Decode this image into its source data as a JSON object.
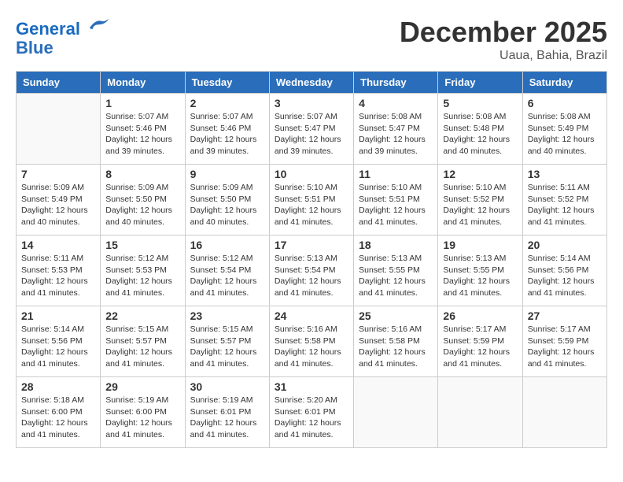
{
  "header": {
    "logo_line1": "General",
    "logo_line2": "Blue",
    "month": "December 2025",
    "location": "Uaua, Bahia, Brazil"
  },
  "weekdays": [
    "Sunday",
    "Monday",
    "Tuesday",
    "Wednesday",
    "Thursday",
    "Friday",
    "Saturday"
  ],
  "weeks": [
    [
      {
        "day": "",
        "empty": true
      },
      {
        "day": "1",
        "sunrise": "5:07 AM",
        "sunset": "5:46 PM",
        "daylight": "12 hours and 39 minutes."
      },
      {
        "day": "2",
        "sunrise": "5:07 AM",
        "sunset": "5:46 PM",
        "daylight": "12 hours and 39 minutes."
      },
      {
        "day": "3",
        "sunrise": "5:07 AM",
        "sunset": "5:47 PM",
        "daylight": "12 hours and 39 minutes."
      },
      {
        "day": "4",
        "sunrise": "5:08 AM",
        "sunset": "5:47 PM",
        "daylight": "12 hours and 39 minutes."
      },
      {
        "day": "5",
        "sunrise": "5:08 AM",
        "sunset": "5:48 PM",
        "daylight": "12 hours and 40 minutes."
      },
      {
        "day": "6",
        "sunrise": "5:08 AM",
        "sunset": "5:49 PM",
        "daylight": "12 hours and 40 minutes."
      }
    ],
    [
      {
        "day": "7",
        "sunrise": "5:09 AM",
        "sunset": "5:49 PM",
        "daylight": "12 hours and 40 minutes."
      },
      {
        "day": "8",
        "sunrise": "5:09 AM",
        "sunset": "5:50 PM",
        "daylight": "12 hours and 40 minutes."
      },
      {
        "day": "9",
        "sunrise": "5:09 AM",
        "sunset": "5:50 PM",
        "daylight": "12 hours and 40 minutes."
      },
      {
        "day": "10",
        "sunrise": "5:10 AM",
        "sunset": "5:51 PM",
        "daylight": "12 hours and 41 minutes."
      },
      {
        "day": "11",
        "sunrise": "5:10 AM",
        "sunset": "5:51 PM",
        "daylight": "12 hours and 41 minutes."
      },
      {
        "day": "12",
        "sunrise": "5:10 AM",
        "sunset": "5:52 PM",
        "daylight": "12 hours and 41 minutes."
      },
      {
        "day": "13",
        "sunrise": "5:11 AM",
        "sunset": "5:52 PM",
        "daylight": "12 hours and 41 minutes."
      }
    ],
    [
      {
        "day": "14",
        "sunrise": "5:11 AM",
        "sunset": "5:53 PM",
        "daylight": "12 hours and 41 minutes."
      },
      {
        "day": "15",
        "sunrise": "5:12 AM",
        "sunset": "5:53 PM",
        "daylight": "12 hours and 41 minutes."
      },
      {
        "day": "16",
        "sunrise": "5:12 AM",
        "sunset": "5:54 PM",
        "daylight": "12 hours and 41 minutes."
      },
      {
        "day": "17",
        "sunrise": "5:13 AM",
        "sunset": "5:54 PM",
        "daylight": "12 hours and 41 minutes."
      },
      {
        "day": "18",
        "sunrise": "5:13 AM",
        "sunset": "5:55 PM",
        "daylight": "12 hours and 41 minutes."
      },
      {
        "day": "19",
        "sunrise": "5:13 AM",
        "sunset": "5:55 PM",
        "daylight": "12 hours and 41 minutes."
      },
      {
        "day": "20",
        "sunrise": "5:14 AM",
        "sunset": "5:56 PM",
        "daylight": "12 hours and 41 minutes."
      }
    ],
    [
      {
        "day": "21",
        "sunrise": "5:14 AM",
        "sunset": "5:56 PM",
        "daylight": "12 hours and 41 minutes."
      },
      {
        "day": "22",
        "sunrise": "5:15 AM",
        "sunset": "5:57 PM",
        "daylight": "12 hours and 41 minutes."
      },
      {
        "day": "23",
        "sunrise": "5:15 AM",
        "sunset": "5:57 PM",
        "daylight": "12 hours and 41 minutes."
      },
      {
        "day": "24",
        "sunrise": "5:16 AM",
        "sunset": "5:58 PM",
        "daylight": "12 hours and 41 minutes."
      },
      {
        "day": "25",
        "sunrise": "5:16 AM",
        "sunset": "5:58 PM",
        "daylight": "12 hours and 41 minutes."
      },
      {
        "day": "26",
        "sunrise": "5:17 AM",
        "sunset": "5:59 PM",
        "daylight": "12 hours and 41 minutes."
      },
      {
        "day": "27",
        "sunrise": "5:17 AM",
        "sunset": "5:59 PM",
        "daylight": "12 hours and 41 minutes."
      }
    ],
    [
      {
        "day": "28",
        "sunrise": "5:18 AM",
        "sunset": "6:00 PM",
        "daylight": "12 hours and 41 minutes."
      },
      {
        "day": "29",
        "sunrise": "5:19 AM",
        "sunset": "6:00 PM",
        "daylight": "12 hours and 41 minutes."
      },
      {
        "day": "30",
        "sunrise": "5:19 AM",
        "sunset": "6:01 PM",
        "daylight": "12 hours and 41 minutes."
      },
      {
        "day": "31",
        "sunrise": "5:20 AM",
        "sunset": "6:01 PM",
        "daylight": "12 hours and 41 minutes."
      },
      {
        "day": "",
        "empty": true
      },
      {
        "day": "",
        "empty": true
      },
      {
        "day": "",
        "empty": true
      }
    ]
  ],
  "labels": {
    "sunrise_prefix": "Sunrise: ",
    "sunset_prefix": "Sunset: ",
    "daylight_prefix": "Daylight: "
  }
}
